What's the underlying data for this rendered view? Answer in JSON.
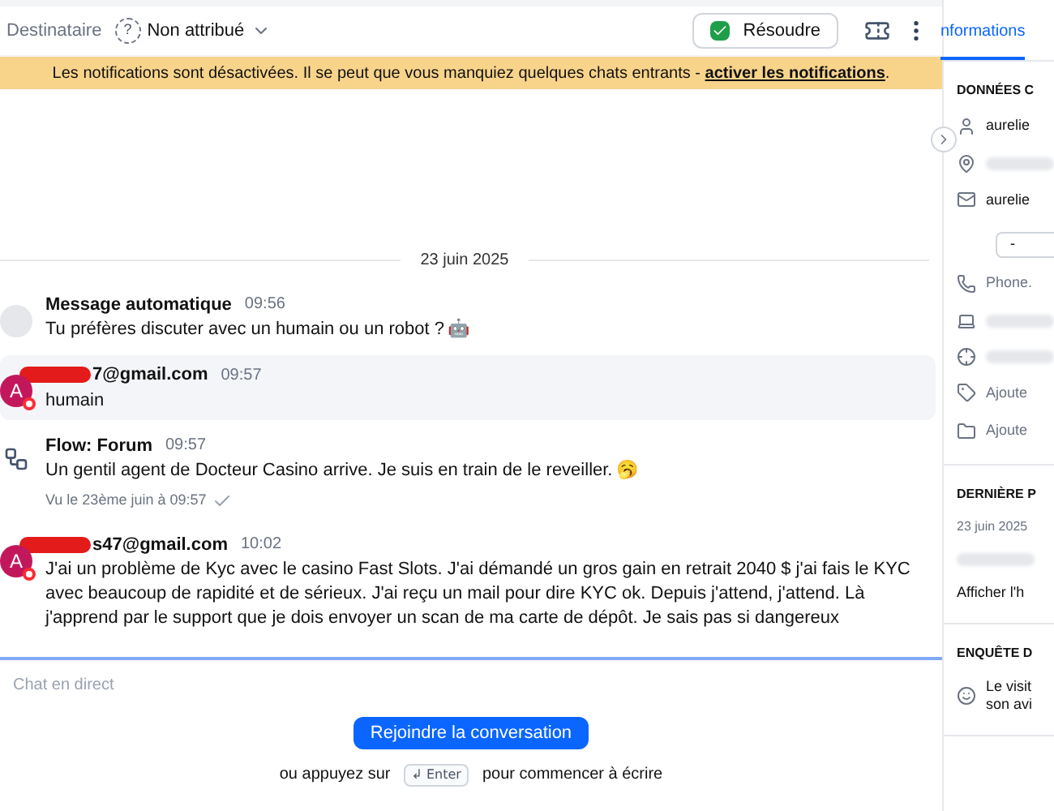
{
  "header": {
    "recipient_label": "Destinataire",
    "help_icon": "?",
    "assignee": "Non attribué",
    "resolve_button": "Résoudre"
  },
  "banner": {
    "text": "Les notifications sont désactivées. Il se peut que vous manquiez quelques chats entrants - ",
    "link": "activer les notifications",
    "end": "."
  },
  "date_separator": "23 juin 2025",
  "messages": [
    {
      "kind": "bot",
      "sender": "Message automatique",
      "time": "09:56",
      "text": "Tu préfères discuter avec un humain ou un robot ?",
      "emoji": "🤖",
      "redacted": false,
      "highlighted": false
    },
    {
      "kind": "visitor",
      "avatar": "A",
      "sender": "7@gmail.com",
      "time": "09:57",
      "text": "humain",
      "redacted": true,
      "highlighted": true
    },
    {
      "kind": "flow",
      "sender": "Flow: Forum",
      "time": "09:57",
      "text": "Un gentil agent de Docteur Casino arrive. Je suis en train de le reveiller.",
      "emoji": "🥱",
      "seen": "Vu le 23ème juin à 09:57",
      "redacted": false,
      "highlighted": false
    },
    {
      "kind": "visitor",
      "avatar": "A",
      "sender": "s47@gmail.com",
      "time": "10:02",
      "text": "J'ai un problème de Kyc avec le casino Fast Slots. J'ai démandé un gros gain en retrait 2040 $ j'ai fais le KYC avec beaucoup de rapidité et de sérieux. J'ai reçu un mail pour dire KYC ok. Depuis j'attend, j'attend. Là j'apprend par le support que je dois envoyer un scan de ma carte de dépôt. Je sais pas si dangereux",
      "redacted": true,
      "highlighted": false
    }
  ],
  "composer": {
    "channel": "Chat en direct",
    "join_button": "Rejoindre la conversation",
    "hint_before": "ou appuyez sur",
    "key": "↲ Enter",
    "hint_after": "pour commencer à écrire"
  },
  "sidebar": {
    "tabs": [
      {
        "label": "nformations",
        "selected": true
      }
    ],
    "sections": [
      {
        "title": "DONNÉES C",
        "rows": [
          {
            "kind": "person",
            "text": "aurelie"
          },
          {
            "kind": "pin",
            "text": ""
          },
          {
            "kind": "mail",
            "text": "aurelie"
          },
          {
            "kind": "select",
            "text": "-"
          },
          {
            "kind": "phone",
            "text": "Phone."
          },
          {
            "kind": "laptop",
            "text": ""
          },
          {
            "kind": "target",
            "text": ""
          },
          {
            "kind": "tag",
            "text": "Ajoute"
          },
          {
            "kind": "folder",
            "text": "Ajoute"
          }
        ]
      },
      {
        "title": "DERNIÈRE P",
        "rows": [
          {
            "kind": "plain",
            "text": "23 juin 2025"
          },
          {
            "kind": "blur",
            "text": ""
          },
          {
            "kind": "link",
            "text": "Afficher l'h"
          }
        ]
      },
      {
        "title": "ENQUÊTE D",
        "rows": [
          {
            "kind": "smiley",
            "lines": [
              "Le visit",
              "son avi"
            ]
          }
        ]
      }
    ]
  }
}
